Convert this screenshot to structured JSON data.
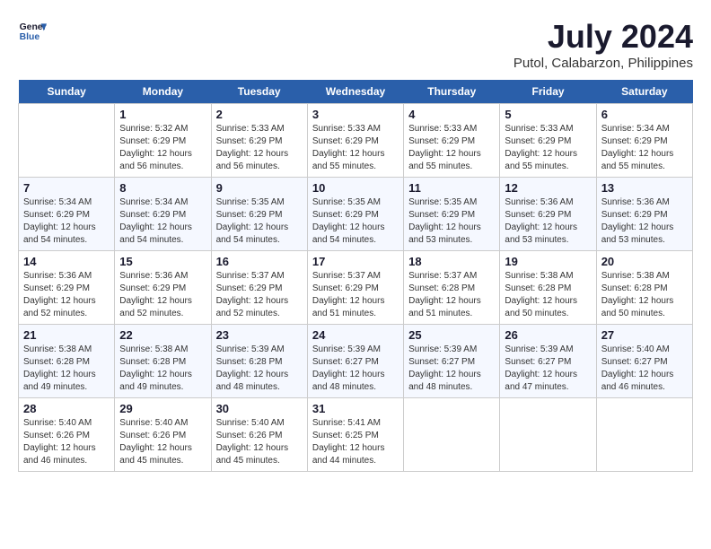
{
  "header": {
    "logo_line1": "General",
    "logo_line2": "Blue",
    "month_year": "July 2024",
    "location": "Putol, Calabarzon, Philippines"
  },
  "weekdays": [
    "Sunday",
    "Monday",
    "Tuesday",
    "Wednesday",
    "Thursday",
    "Friday",
    "Saturday"
  ],
  "weeks": [
    [
      {
        "day": "",
        "info": ""
      },
      {
        "day": "1",
        "info": "Sunrise: 5:32 AM\nSunset: 6:29 PM\nDaylight: 12 hours\nand 56 minutes."
      },
      {
        "day": "2",
        "info": "Sunrise: 5:33 AM\nSunset: 6:29 PM\nDaylight: 12 hours\nand 56 minutes."
      },
      {
        "day": "3",
        "info": "Sunrise: 5:33 AM\nSunset: 6:29 PM\nDaylight: 12 hours\nand 55 minutes."
      },
      {
        "day": "4",
        "info": "Sunrise: 5:33 AM\nSunset: 6:29 PM\nDaylight: 12 hours\nand 55 minutes."
      },
      {
        "day": "5",
        "info": "Sunrise: 5:33 AM\nSunset: 6:29 PM\nDaylight: 12 hours\nand 55 minutes."
      },
      {
        "day": "6",
        "info": "Sunrise: 5:34 AM\nSunset: 6:29 PM\nDaylight: 12 hours\nand 55 minutes."
      }
    ],
    [
      {
        "day": "7",
        "info": "Sunrise: 5:34 AM\nSunset: 6:29 PM\nDaylight: 12 hours\nand 54 minutes."
      },
      {
        "day": "8",
        "info": "Sunrise: 5:34 AM\nSunset: 6:29 PM\nDaylight: 12 hours\nand 54 minutes."
      },
      {
        "day": "9",
        "info": "Sunrise: 5:35 AM\nSunset: 6:29 PM\nDaylight: 12 hours\nand 54 minutes."
      },
      {
        "day": "10",
        "info": "Sunrise: 5:35 AM\nSunset: 6:29 PM\nDaylight: 12 hours\nand 54 minutes."
      },
      {
        "day": "11",
        "info": "Sunrise: 5:35 AM\nSunset: 6:29 PM\nDaylight: 12 hours\nand 53 minutes."
      },
      {
        "day": "12",
        "info": "Sunrise: 5:36 AM\nSunset: 6:29 PM\nDaylight: 12 hours\nand 53 minutes."
      },
      {
        "day": "13",
        "info": "Sunrise: 5:36 AM\nSunset: 6:29 PM\nDaylight: 12 hours\nand 53 minutes."
      }
    ],
    [
      {
        "day": "14",
        "info": "Sunrise: 5:36 AM\nSunset: 6:29 PM\nDaylight: 12 hours\nand 52 minutes."
      },
      {
        "day": "15",
        "info": "Sunrise: 5:36 AM\nSunset: 6:29 PM\nDaylight: 12 hours\nand 52 minutes."
      },
      {
        "day": "16",
        "info": "Sunrise: 5:37 AM\nSunset: 6:29 PM\nDaylight: 12 hours\nand 52 minutes."
      },
      {
        "day": "17",
        "info": "Sunrise: 5:37 AM\nSunset: 6:29 PM\nDaylight: 12 hours\nand 51 minutes."
      },
      {
        "day": "18",
        "info": "Sunrise: 5:37 AM\nSunset: 6:28 PM\nDaylight: 12 hours\nand 51 minutes."
      },
      {
        "day": "19",
        "info": "Sunrise: 5:38 AM\nSunset: 6:28 PM\nDaylight: 12 hours\nand 50 minutes."
      },
      {
        "day": "20",
        "info": "Sunrise: 5:38 AM\nSunset: 6:28 PM\nDaylight: 12 hours\nand 50 minutes."
      }
    ],
    [
      {
        "day": "21",
        "info": "Sunrise: 5:38 AM\nSunset: 6:28 PM\nDaylight: 12 hours\nand 49 minutes."
      },
      {
        "day": "22",
        "info": "Sunrise: 5:38 AM\nSunset: 6:28 PM\nDaylight: 12 hours\nand 49 minutes."
      },
      {
        "day": "23",
        "info": "Sunrise: 5:39 AM\nSunset: 6:28 PM\nDaylight: 12 hours\nand 48 minutes."
      },
      {
        "day": "24",
        "info": "Sunrise: 5:39 AM\nSunset: 6:27 PM\nDaylight: 12 hours\nand 48 minutes."
      },
      {
        "day": "25",
        "info": "Sunrise: 5:39 AM\nSunset: 6:27 PM\nDaylight: 12 hours\nand 48 minutes."
      },
      {
        "day": "26",
        "info": "Sunrise: 5:39 AM\nSunset: 6:27 PM\nDaylight: 12 hours\nand 47 minutes."
      },
      {
        "day": "27",
        "info": "Sunrise: 5:40 AM\nSunset: 6:27 PM\nDaylight: 12 hours\nand 46 minutes."
      }
    ],
    [
      {
        "day": "28",
        "info": "Sunrise: 5:40 AM\nSunset: 6:26 PM\nDaylight: 12 hours\nand 46 minutes."
      },
      {
        "day": "29",
        "info": "Sunrise: 5:40 AM\nSunset: 6:26 PM\nDaylight: 12 hours\nand 45 minutes."
      },
      {
        "day": "30",
        "info": "Sunrise: 5:40 AM\nSunset: 6:26 PM\nDaylight: 12 hours\nand 45 minutes."
      },
      {
        "day": "31",
        "info": "Sunrise: 5:41 AM\nSunset: 6:25 PM\nDaylight: 12 hours\nand 44 minutes."
      },
      {
        "day": "",
        "info": ""
      },
      {
        "day": "",
        "info": ""
      },
      {
        "day": "",
        "info": ""
      }
    ]
  ]
}
